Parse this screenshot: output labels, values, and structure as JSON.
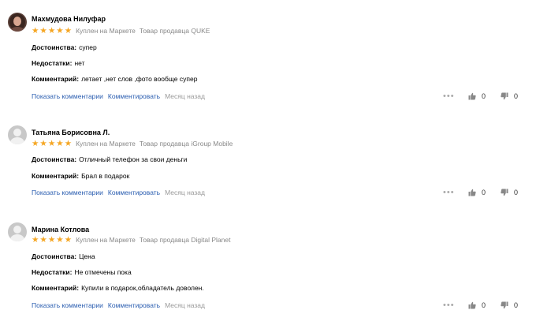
{
  "colors": {
    "link": "#2a5db0",
    "star": "#f5a623",
    "muted": "#888888"
  },
  "reviews": [
    {
      "author": "Махмудова Нилуфар",
      "avatar": "photo",
      "rating": 5,
      "badge": "Куплен на Маркете",
      "seller": "Товар продавца QUKE",
      "pros_label": "Достоинства:",
      "pros": "супер",
      "cons_label": "Недостатки:",
      "cons": "нет",
      "comment_label": "Комментарий:",
      "comment": "летает ,нет слов ,фото вообще супер",
      "show_comments": "Показать комментарии",
      "write_comment": "Комментировать",
      "date": "Месяц назад",
      "likes": "0",
      "dislikes": "0"
    },
    {
      "author": "Татьяна Борисовна Л.",
      "avatar": "placeholder",
      "rating": 5,
      "badge": "Куплен на Маркете",
      "seller": "Товар продавца iGroup Mobile",
      "pros_label": "Достоинства:",
      "pros": "Отличный телефон за свои деньги",
      "comment_label": "Комментарий:",
      "comment": "Брал в подарок",
      "show_comments": "Показать комментарии",
      "write_comment": "Комментировать",
      "date": "Месяц назад",
      "likes": "0",
      "dislikes": "0"
    },
    {
      "author": "Марина Котлова",
      "avatar": "placeholder",
      "rating": 5,
      "badge": "Куплен на Маркете",
      "seller": "Товар продавца Digital Planet",
      "pros_label": "Достоинства:",
      "pros": "Цена",
      "cons_label": "Недостатки:",
      "cons": "Не отмечены пока",
      "comment_label": "Комментарий:",
      "comment": "Купили в подарок,обладатель доволен.",
      "show_comments": "Показать комментарии",
      "write_comment": "Комментировать",
      "date": "Месяц назад",
      "likes": "0",
      "dislikes": "0"
    }
  ]
}
